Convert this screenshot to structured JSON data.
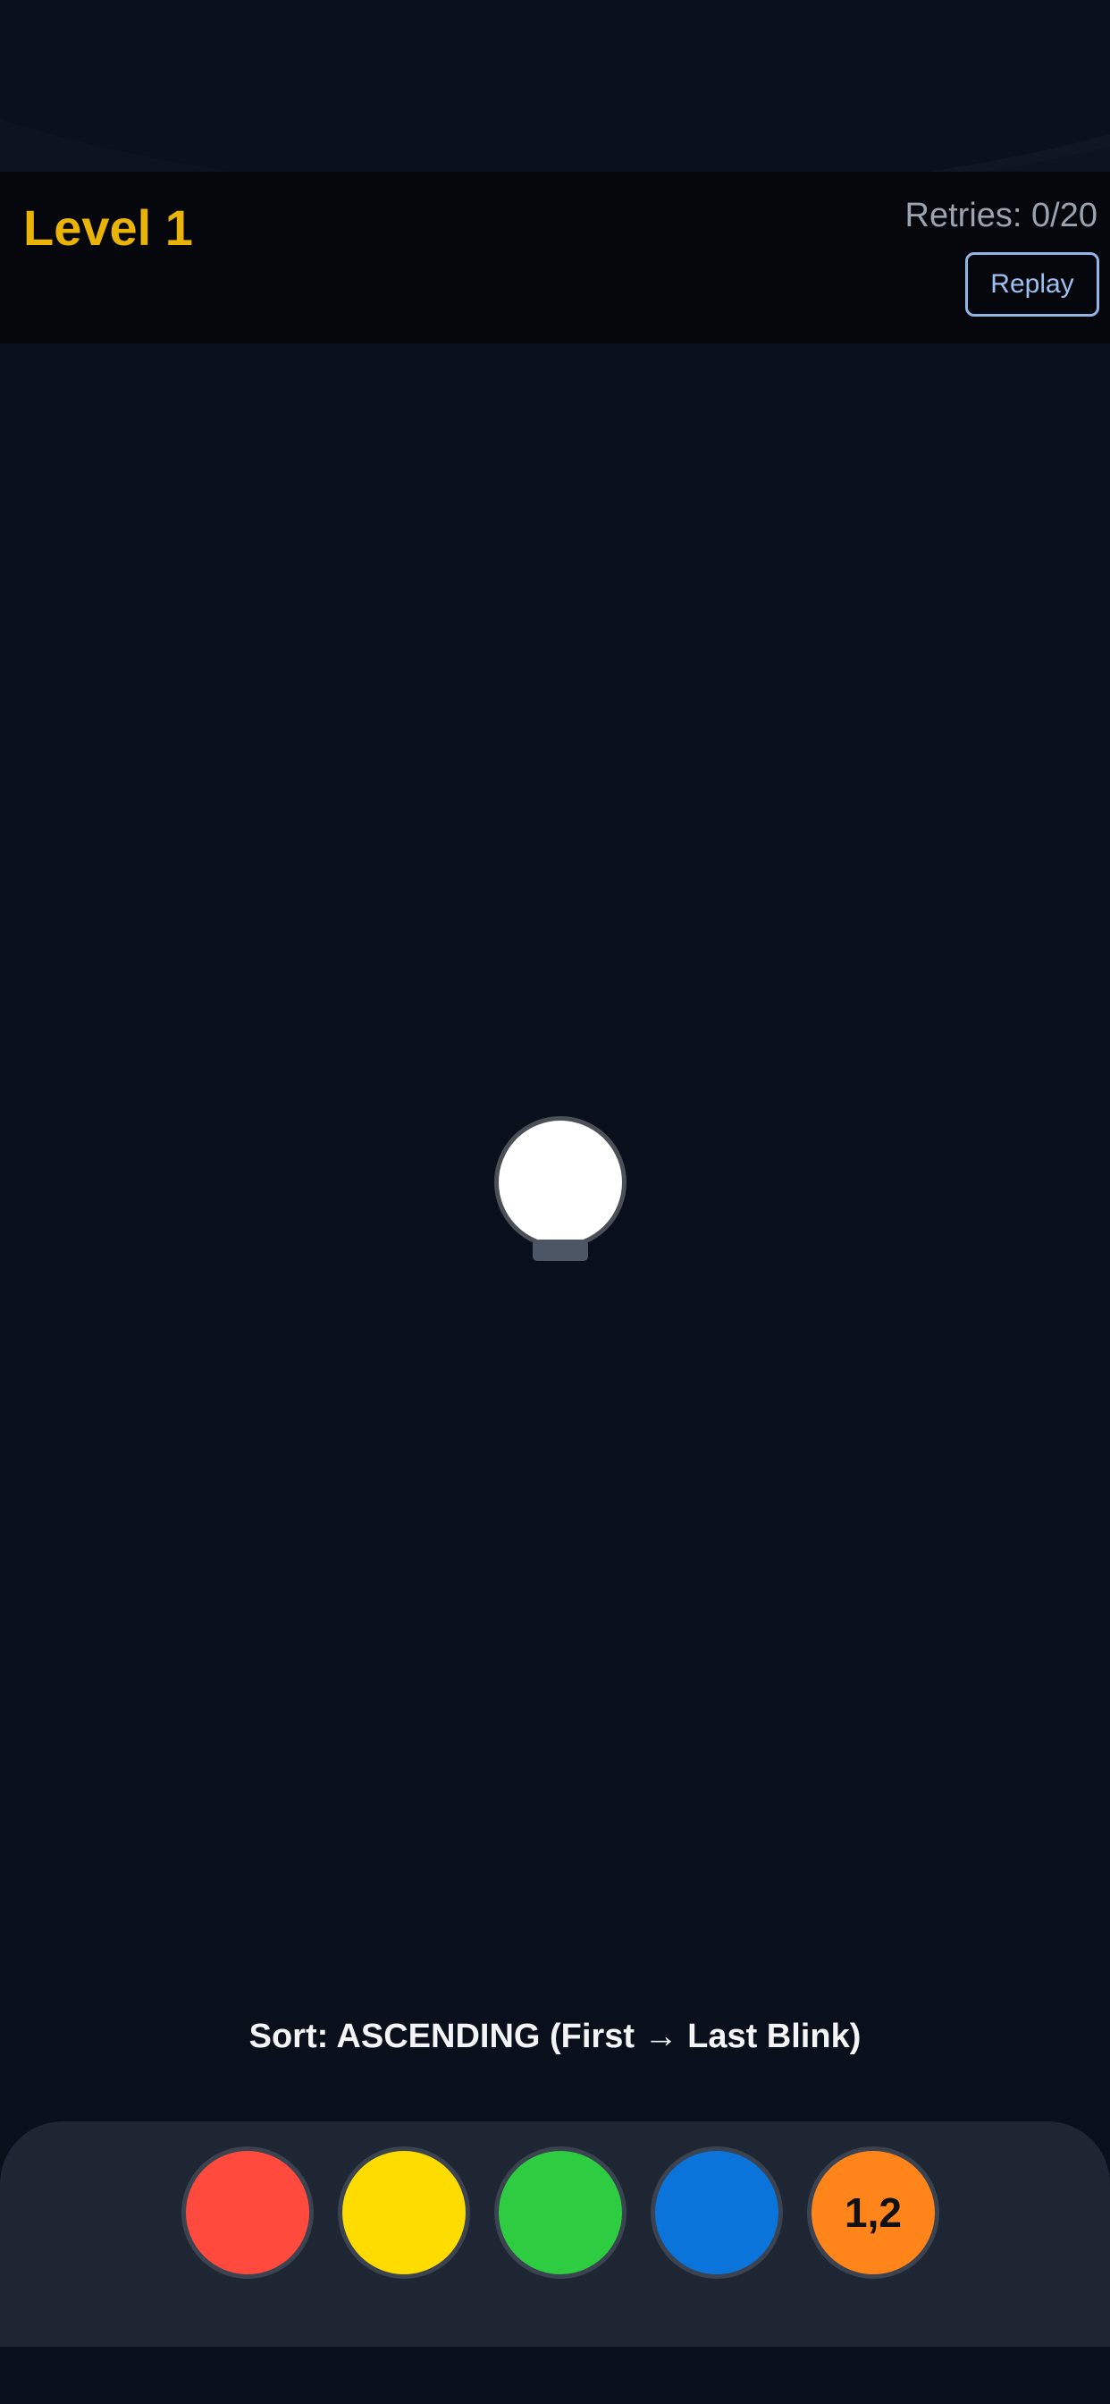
{
  "header": {
    "level_title": "Level 1",
    "retries": "Retries: 0/20",
    "replay_label": "Replay"
  },
  "game": {
    "bulb_color": "#ffffff",
    "sort_instruction": "Sort: ASCENDING (First → Last Blink)"
  },
  "colors": {
    "level_title": "#eab308",
    "background": "#0a0f1c"
  },
  "buttons": [
    {
      "name": "red",
      "color": "#ff4a3d",
      "label": ""
    },
    {
      "name": "yellow",
      "color": "#ffdc00",
      "label": ""
    },
    {
      "name": "green",
      "color": "#2ecc40",
      "label": ""
    },
    {
      "name": "blue",
      "color": "#0a74da",
      "label": ""
    },
    {
      "name": "orange",
      "color": "#ff851b",
      "label": "1,2"
    }
  ]
}
